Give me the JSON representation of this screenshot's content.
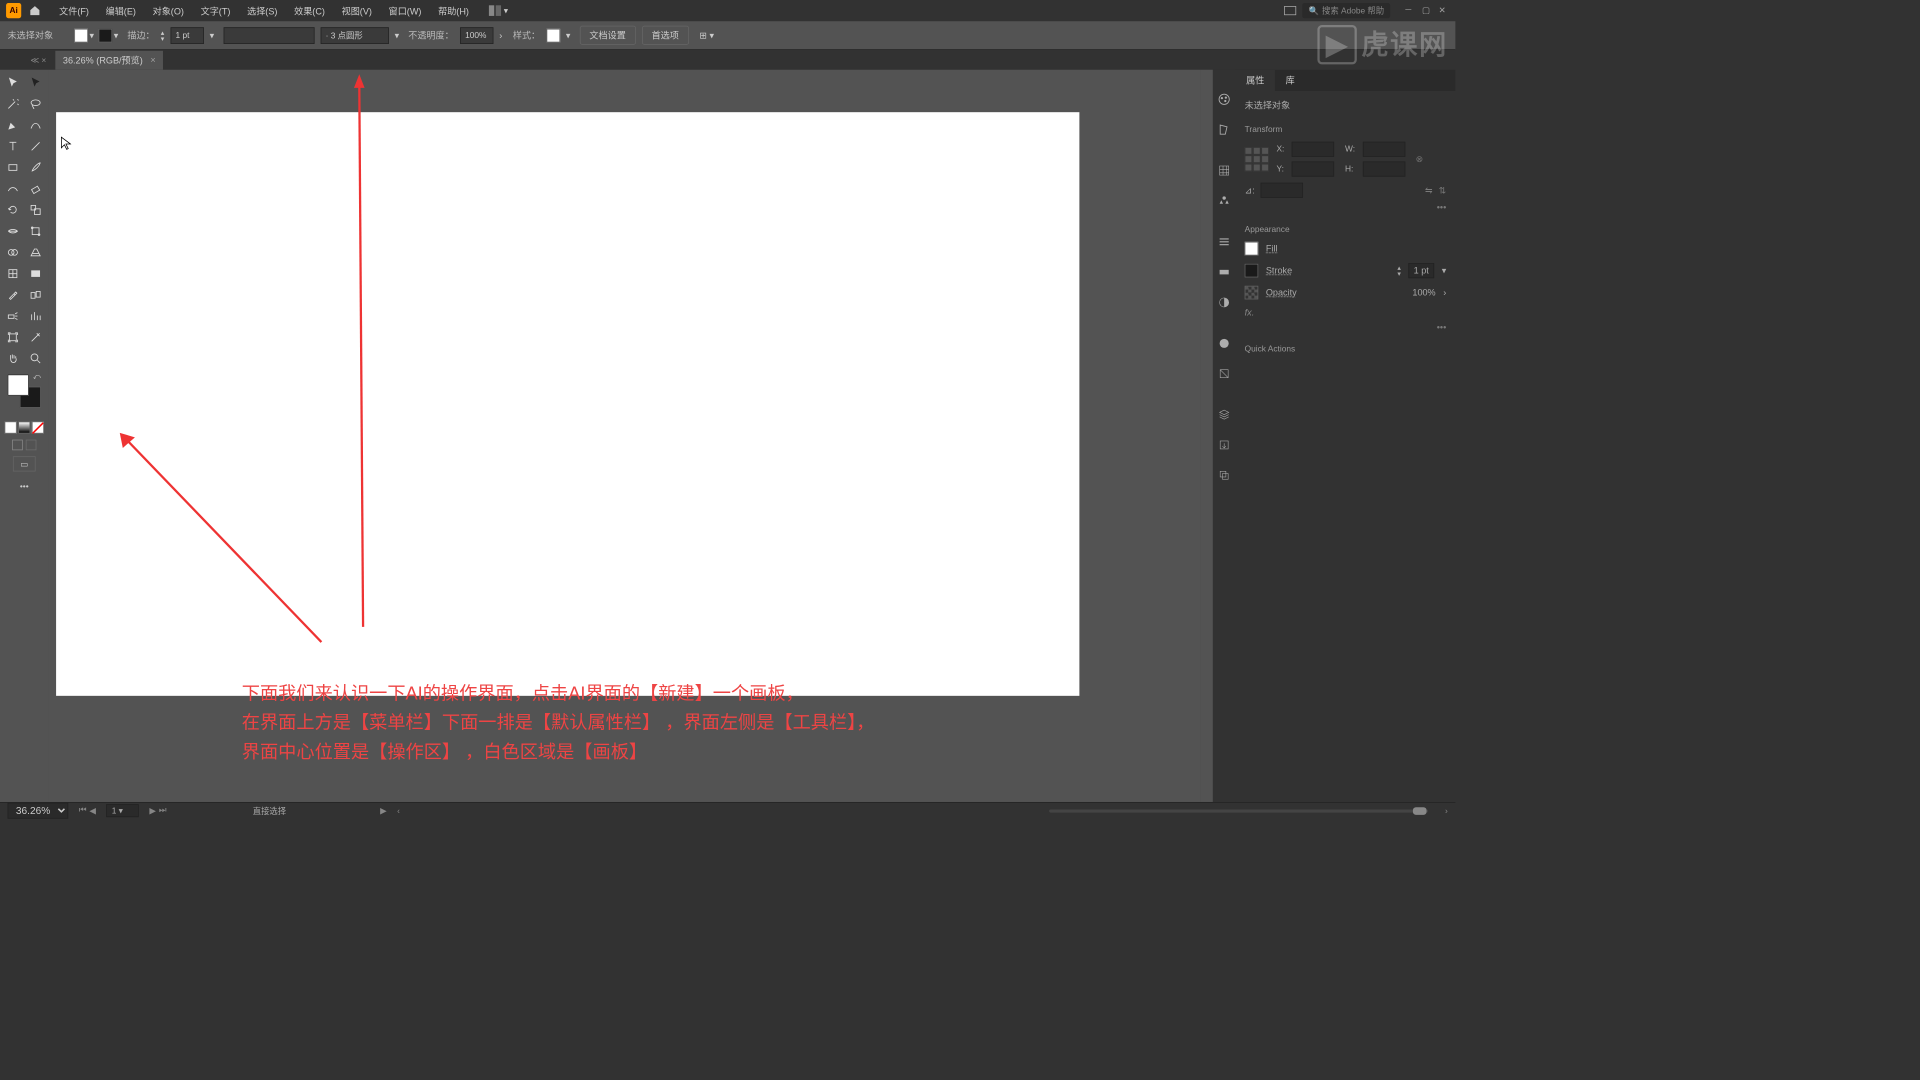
{
  "menubar": [
    "文件(F)",
    "编辑(E)",
    "对象(O)",
    "文字(T)",
    "选择(S)",
    "效果(C)",
    "视图(V)",
    "窗口(W)",
    "帮助(H)"
  ],
  "search_placeholder": "搜索 Adobe 帮助",
  "controlbar": {
    "noselection": "未选择对象",
    "stroke_label": "描边：",
    "stroke_weight": "1 pt",
    "brush_preset": "· 3 点圆形",
    "opacity_label": "不透明度：",
    "opacity_value": "100%",
    "style_label": "样式：",
    "doc_setup": "文档设置",
    "prefs": "首选项"
  },
  "doc_tab": {
    "title": "36.26% (RGB/预览)"
  },
  "annotation": {
    "line1": "下面我们来认识一下AI的操作界面，点击AI界面的【新建】一个画板，",
    "line2": "在界面上方是【菜单栏】下面一排是【默认属性栏】 ，界面左侧是【工具栏】，",
    "line3": "界面中心位置是【操作区】 ，白色区域是【画板】"
  },
  "panels": {
    "tabs": [
      "属性",
      "库"
    ],
    "noselection": "未选择对象",
    "transform_h": "Transform",
    "labels": {
      "x": "X:",
      "y": "Y:",
      "w": "W:",
      "h": "H:",
      "angle": "⊿:"
    },
    "appearance_h": "Appearance",
    "fill": "Fill",
    "stroke": "Stroke",
    "stroke_weight": "1 pt",
    "opacity": "Opacity",
    "opacity_value": "100%",
    "fx": "fx.",
    "quick": "Quick Actions"
  },
  "status": {
    "zoom": "36.26%",
    "artboard_num": "1",
    "tool_hint": "直接选择"
  },
  "watermark": "虎课网"
}
